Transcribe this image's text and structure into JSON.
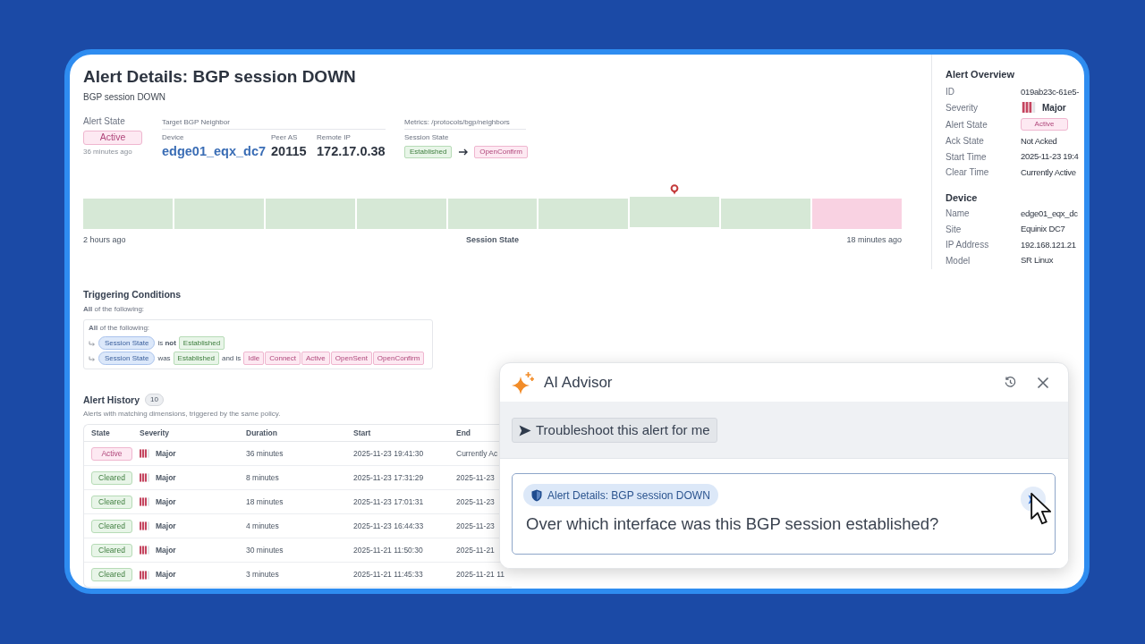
{
  "page": {
    "title": "Alert Details: BGP session DOWN",
    "subtitle": "BGP session DOWN"
  },
  "summary": {
    "alert_state": {
      "label": "Alert State",
      "badge": {
        "text": "Active",
        "kind": "alert"
      },
      "since": "36 minutes ago"
    },
    "target": {
      "heading": "Target BGP Neighbor",
      "fields": [
        {
          "label": "Device",
          "value": "edge01_eqx_dc7",
          "kind": "link"
        },
        {
          "label": "Peer AS",
          "value": "20115",
          "kind": "plain"
        },
        {
          "label": "Remote IP",
          "value": "172.17.0.38",
          "kind": "plain"
        }
      ]
    },
    "metrics": {
      "heading": "Metrics: /protocols/bgp/neighbors",
      "label": "Session State",
      "transition": [
        {
          "text": "Established",
          "kind": "ok"
        },
        {
          "text": "OpenConfirm",
          "kind": "alert"
        }
      ]
    }
  },
  "timeline": {
    "segments": [
      {
        "color": "#d6e8d6",
        "marked": false
      },
      {
        "color": "#d6e8d6",
        "marked": false
      },
      {
        "color": "#d6e8d6",
        "marked": false
      },
      {
        "color": "#d6e8d6",
        "marked": false
      },
      {
        "color": "#d6e8d6",
        "marked": false
      },
      {
        "color": "#d6e8d6",
        "marked": false
      },
      {
        "color": "#d6e8d6",
        "marked": true
      },
      {
        "color": "#d6e8d6",
        "marked": false
      },
      {
        "color": "#f9d2e2",
        "marked": false
      }
    ],
    "start_label": "2 hours ago",
    "title": "Session State",
    "end_label": "18 minutes ago"
  },
  "conditions": {
    "title": "Triggering Conditions",
    "intro": "**All** of the following:",
    "group": {
      "intro": "**All** of the following:",
      "rules": [
        {
          "field": "Session State",
          "parts": [
            {
              "kind": "text",
              "text": "is **not**"
            },
            {
              "kind": "ok",
              "text": "Established"
            }
          ]
        },
        {
          "field": "Session State",
          "parts": [
            {
              "kind": "text",
              "text": "was"
            },
            {
              "kind": "ok",
              "text": "Established"
            },
            {
              "kind": "text",
              "text": "and is"
            },
            {
              "kind": "alert",
              "text": "Idle"
            },
            {
              "kind": "alert",
              "text": "Connect"
            },
            {
              "kind": "alert",
              "text": "Active"
            },
            {
              "kind": "alert",
              "text": "OpenSent"
            },
            {
              "kind": "alert",
              "text": "OpenConfirm"
            }
          ]
        }
      ]
    }
  },
  "history": {
    "title": "Alert History",
    "count": "10",
    "subtitle": "Alerts with matching dimensions, triggered by the same policy.",
    "columns": [
      "State",
      "Severity",
      "Duration",
      "Start",
      "End"
    ],
    "rows": [
      {
        "state": {
          "text": "Active",
          "kind": "alert"
        },
        "severity": "Major",
        "duration": "36 minutes",
        "start": "2025-11-23 19:41:30",
        "end": "Currently Ac"
      },
      {
        "state": {
          "text": "Cleared",
          "kind": "ok"
        },
        "severity": "Major",
        "duration": "8 minutes",
        "start": "2025-11-23 17:31:29",
        "end": "2025-11-23"
      },
      {
        "state": {
          "text": "Cleared",
          "kind": "ok"
        },
        "severity": "Major",
        "duration": "18 minutes",
        "start": "2025-11-23 17:01:31",
        "end": "2025-11-23"
      },
      {
        "state": {
          "text": "Cleared",
          "kind": "ok"
        },
        "severity": "Major",
        "duration": "4 minutes",
        "start": "2025-11-23 16:44:33",
        "end": "2025-11-23"
      },
      {
        "state": {
          "text": "Cleared",
          "kind": "ok"
        },
        "severity": "Major",
        "duration": "30 minutes",
        "start": "2025-11-21 11:50:30",
        "end": "2025-11-21"
      },
      {
        "state": {
          "text": "Cleared",
          "kind": "ok"
        },
        "severity": "Major",
        "duration": "3 minutes",
        "start": "2025-11-21 11:45:33",
        "end": "2025-11-21 11"
      }
    ]
  },
  "overview": {
    "sections": [
      {
        "title": "Alert Overview",
        "rows": [
          {
            "label": "ID",
            "value": "019ab23c-61e5-",
            "kind": "text"
          },
          {
            "label": "Severity",
            "value": "Major",
            "kind": "severity"
          },
          {
            "label": "Alert State",
            "kind": "badge",
            "badge": {
              "text": "Active",
              "kind": "alert"
            }
          },
          {
            "label": "Ack State",
            "value": "Not Acked",
            "kind": "text"
          },
          {
            "label": "Start Time",
            "value": "2025-11-23 19:4",
            "kind": "text"
          },
          {
            "label": "Clear Time",
            "value": "Currently Active",
            "kind": "text"
          }
        ]
      },
      {
        "title": "Device",
        "rows": [
          {
            "label": "Name",
            "value": "edge01_eqx_dc",
            "kind": "text"
          },
          {
            "label": "Site",
            "value": "Equinix DC7",
            "kind": "text"
          },
          {
            "label": "IP Address",
            "value": "192.168.121.21",
            "kind": "text"
          },
          {
            "label": "Model",
            "value": "SR Linux",
            "kind": "text"
          }
        ]
      }
    ]
  },
  "advisor": {
    "title": "AI Advisor",
    "suggestions": [
      {
        "text": "Troubleshoot this alert for me"
      }
    ],
    "input": {
      "context": "Alert Details: BGP session DOWN",
      "value": "Over which interface was this BGP session established?"
    }
  }
}
